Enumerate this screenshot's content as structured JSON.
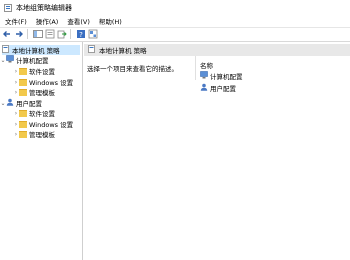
{
  "window": {
    "title": "本地组策略编辑器"
  },
  "menu": {
    "items": [
      "文件(F)",
      "操作(A)",
      "查看(V)",
      "帮助(H)"
    ]
  },
  "tree": {
    "root": "本地计算机 策略",
    "computer_config": "计算机配置",
    "user_config": "用户配置",
    "software_settings": "软件设置",
    "windows_settings": "Windows 设置",
    "admin_templates": "管理模板"
  },
  "right_pane": {
    "header": "本地计算机 策略",
    "description": "选择一个项目来查看它的描述。",
    "column_name": "名称",
    "items": [
      "计算机配置",
      "用户配置"
    ]
  },
  "colors": {
    "selection": "#cce8ff",
    "header_bg": "#e8e8e8",
    "folder": "#f2c94c"
  }
}
